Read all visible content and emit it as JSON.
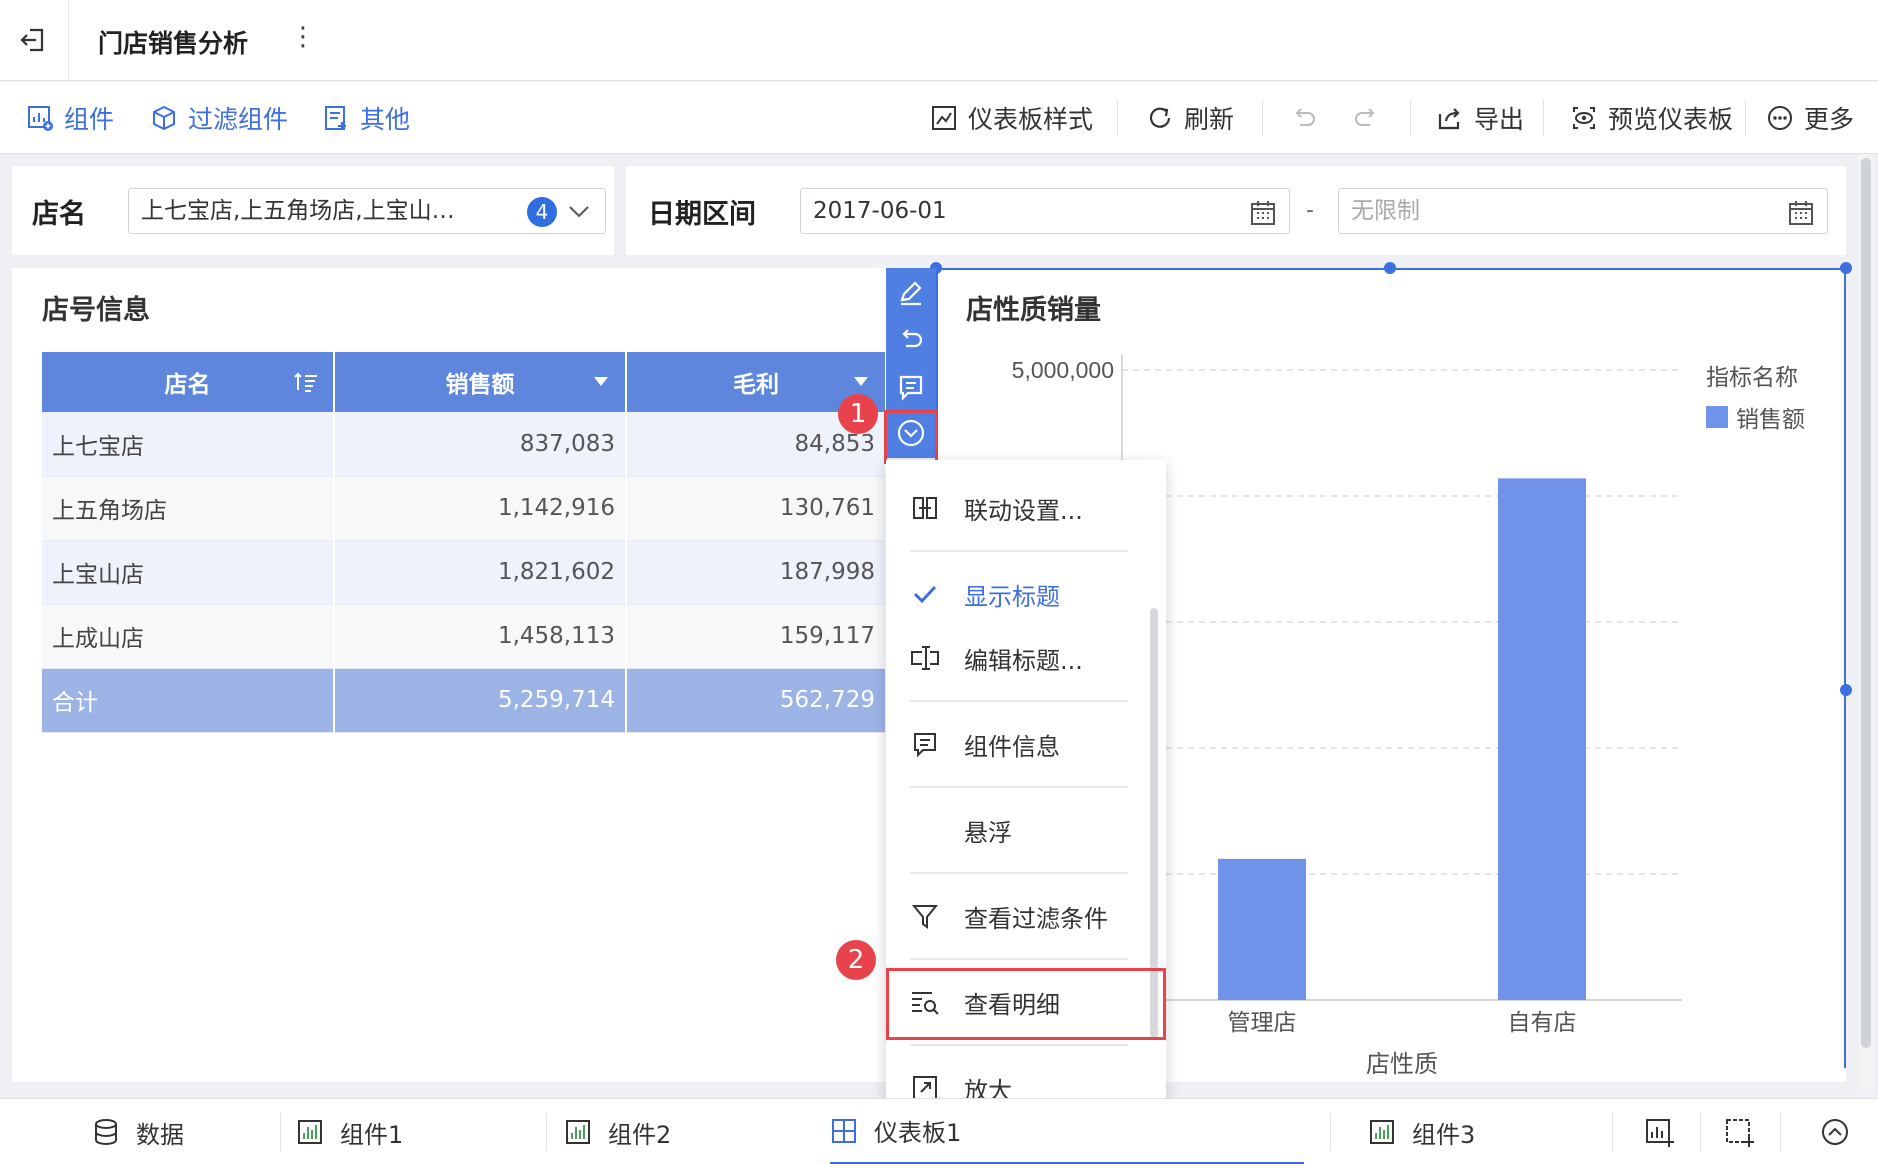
{
  "header": {
    "title": "门店销售分析"
  },
  "toolbar": {
    "left": [
      {
        "label": "组件",
        "icon": "add-chart-icon"
      },
      {
        "label": "过滤组件",
        "icon": "filter-cube-icon"
      },
      {
        "label": "其他",
        "icon": "other-doc-icon"
      }
    ],
    "right": [
      {
        "label": "仪表板样式",
        "icon": "dashboard-style-icon"
      },
      {
        "label": "刷新",
        "icon": "refresh-icon"
      },
      {
        "label": "导出",
        "icon": "export-icon"
      },
      {
        "label": "预览仪表板",
        "icon": "preview-eye-icon"
      },
      {
        "label": "更多",
        "icon": "more-circle-icon"
      }
    ]
  },
  "filters": {
    "store": {
      "label": "店名",
      "value": "上七宝店,上五角场店,上宝山…",
      "count": "4"
    },
    "date": {
      "label": "日期区间",
      "start": "2017-06-01",
      "separator": "-",
      "end_placeholder": "无限制"
    }
  },
  "table_card": {
    "title": "店号信息",
    "columns": [
      "店名",
      "销售额",
      "毛利"
    ],
    "rows": [
      {
        "name": "上七宝店",
        "sales": "837,083",
        "profit": "84,853"
      },
      {
        "name": "上五角场店",
        "sales": "1,142,916",
        "profit": "130,761"
      },
      {
        "name": "上宝山店",
        "sales": "1,821,602",
        "profit": "187,998"
      },
      {
        "name": "上成山店",
        "sales": "1,458,113",
        "profit": "159,117"
      }
    ],
    "total": {
      "name": "合计",
      "sales": "5,259,714",
      "profit": "562,729"
    }
  },
  "chart_card": {
    "title": "店性质销量"
  },
  "chart_data": {
    "type": "bar",
    "title": "店性质销量",
    "categories": [
      "管理店",
      "自有店"
    ],
    "series": [
      {
        "name": "销售额",
        "values": [
          1120000,
          4140000
        ]
      }
    ],
    "xlabel": "店性质",
    "ylabel": "",
    "ylim": [
      0,
      5000000
    ],
    "y_tick_label": "5,000,000",
    "legend_title": "指标名称",
    "legend_position": "top-right",
    "grid": true,
    "bar_color": "#6e93e8"
  },
  "markers": [
    "1",
    "2"
  ],
  "menu": {
    "items": [
      {
        "label": "联动设置...",
        "icon": "link-settings-icon"
      },
      {
        "label": "显示标题",
        "icon": "check-icon",
        "checked": true
      },
      {
        "label": "编辑标题...",
        "icon": "edit-title-icon"
      },
      {
        "label": "组件信息",
        "icon": "component-info-icon"
      },
      {
        "label": "悬浮",
        "icon": ""
      },
      {
        "label": "查看过滤条件",
        "icon": "filter-funnel-icon"
      },
      {
        "label": "查看明细",
        "icon": "view-detail-icon"
      },
      {
        "label": "放大",
        "icon": "enlarge-icon"
      }
    ]
  },
  "bottom_tabs": [
    {
      "label": "数据",
      "icon": "database-icon"
    },
    {
      "label": "组件1",
      "icon": "bar-chart-icon"
    },
    {
      "label": "组件2",
      "icon": "bar-chart-icon"
    },
    {
      "label": "仪表板1",
      "icon": "dashboard-grid-icon"
    },
    {
      "label": "组件3",
      "icon": "bar-chart-icon"
    }
  ],
  "colors": {
    "accent": "#3d6fe0",
    "header": "#5d86dc",
    "highlight": "#e8424a"
  }
}
